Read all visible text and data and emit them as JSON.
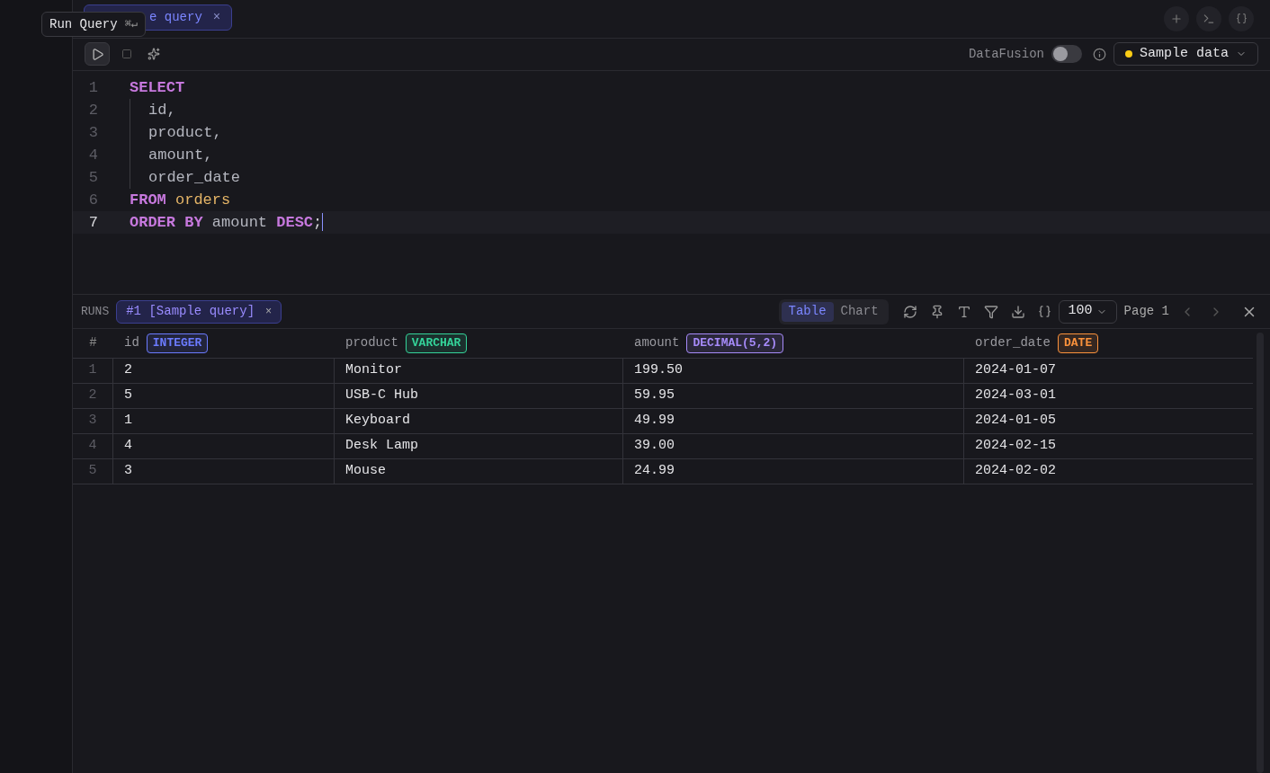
{
  "tooltip": {
    "label": "Run Query",
    "shortcut": "⌘↵"
  },
  "query_tab": {
    "label": "e query",
    "close": "×",
    "selected": true
  },
  "toolbar": {
    "engine_label": "DataFusion",
    "engine_on": false,
    "source": "Sample data"
  },
  "editor_lines": [
    {
      "number": "1",
      "indented": false,
      "selected": false,
      "tokens": [
        {
          "kind": "keyword",
          "text": "SELECT"
        }
      ]
    },
    {
      "number": "2",
      "indented": true,
      "selected": false,
      "tokens": [
        {
          "kind": "ident",
          "text": "id,"
        }
      ]
    },
    {
      "number": "3",
      "indented": true,
      "selected": false,
      "tokens": [
        {
          "kind": "ident",
          "text": "product,"
        }
      ]
    },
    {
      "number": "4",
      "indented": true,
      "selected": false,
      "tokens": [
        {
          "kind": "ident",
          "text": "amount,"
        }
      ]
    },
    {
      "number": "5",
      "indented": true,
      "selected": false,
      "tokens": [
        {
          "kind": "ident",
          "text": "order_date"
        }
      ]
    },
    {
      "number": "6",
      "indented": false,
      "selected": false,
      "tokens": [
        {
          "kind": "keyword",
          "text": "FROM"
        },
        {
          "kind": "table",
          "text": "orders"
        }
      ]
    },
    {
      "number": "7",
      "indented": false,
      "selected": true,
      "tokens": [
        {
          "kind": "keyword",
          "text": "ORDER BY"
        },
        {
          "kind": "ident",
          "text": "amount"
        },
        {
          "kind": "keyword",
          "text": "DESC"
        },
        {
          "kind": "punct",
          "text": ";"
        }
      ]
    }
  ],
  "runs": {
    "label": "RUNS",
    "items": [
      {
        "label": "#1 [Sample query]",
        "close": "×",
        "selected": true
      }
    ]
  },
  "view_tabs": [
    {
      "label": "Table",
      "selected": true
    },
    {
      "label": "Chart",
      "selected": false
    }
  ],
  "page_size": "100",
  "page": "Page 1",
  "table": {
    "index_header": "#",
    "columns": [
      {
        "name": "id",
        "type": "INTEGER",
        "color": "#6b7bff"
      },
      {
        "name": "product",
        "type": "VARCHAR",
        "color": "#34d399"
      },
      {
        "name": "amount",
        "type": "DECIMAL(5,2)",
        "color": "#a78bfa"
      },
      {
        "name": "order_date",
        "type": "DATE",
        "color": "#fb923c"
      }
    ],
    "rows": [
      {
        "index": "1",
        "cells": [
          "2",
          "Monitor",
          "199.50",
          "2024-01-07"
        ]
      },
      {
        "index": "2",
        "cells": [
          "5",
          "USB-C Hub",
          "59.95",
          "2024-03-01"
        ]
      },
      {
        "index": "3",
        "cells": [
          "1",
          "Keyboard",
          "49.99",
          "2024-01-05"
        ]
      },
      {
        "index": "4",
        "cells": [
          "4",
          "Desk Lamp",
          "39.00",
          "2024-02-15"
        ]
      },
      {
        "index": "5",
        "cells": [
          "3",
          "Mouse",
          "24.99",
          "2024-02-02"
        ]
      }
    ]
  }
}
